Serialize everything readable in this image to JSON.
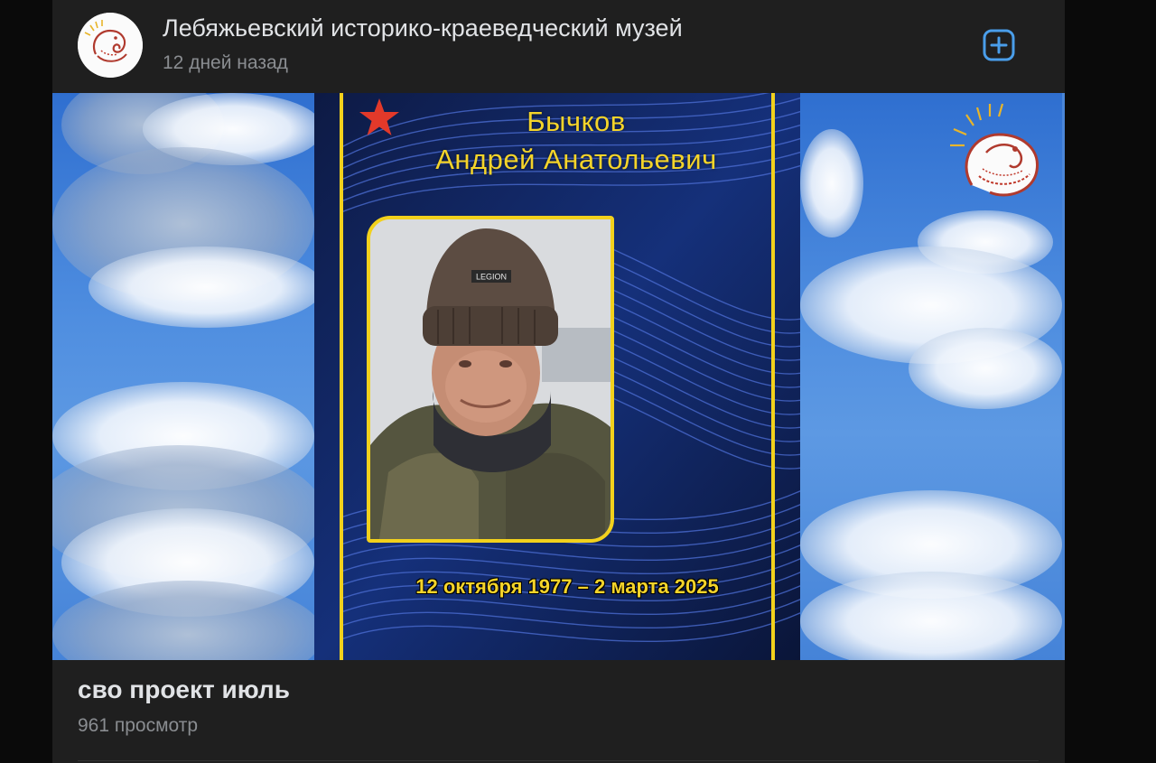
{
  "post": {
    "channel_name": "Лебяжьевский историко-краеведческий музей",
    "posted_ago": "12 дней назад",
    "add_icon": "plus-square-icon",
    "accent_color": "#4a9eea"
  },
  "video": {
    "poster_name_line1": "Бычков",
    "poster_name_line2": "Андрей Анатольевич",
    "poster_dates": "12 октября 1977 – 2 марта 2025",
    "hat_label": "LEGION",
    "frame_color": "#f2d11c"
  },
  "meta": {
    "title": "сво проект июль",
    "views": "961 просмотр"
  }
}
